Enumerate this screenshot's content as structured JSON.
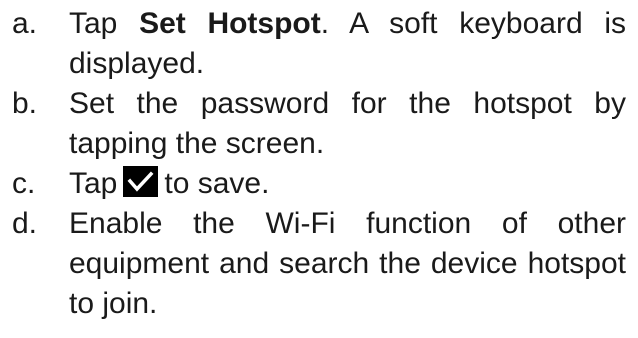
{
  "steps": [
    {
      "marker": "a.",
      "prefix": "Tap ",
      "bold": "Set Hotspot",
      "suffix": ". A soft keyboard is displayed."
    },
    {
      "marker": "b.",
      "text": "Set the password for the hotspot by tapping the screen."
    },
    {
      "marker": "c.",
      "prefix": "Tap",
      "icon": "checkmark-icon",
      "suffix": "to save."
    },
    {
      "marker": "d.",
      "text": "Enable the Wi-Fi function of other equipment and search the device hotspot to join."
    }
  ],
  "colors": {
    "text": "#1a1a1a",
    "icon_bg": "#000000",
    "icon_check": "#ffffff"
  }
}
